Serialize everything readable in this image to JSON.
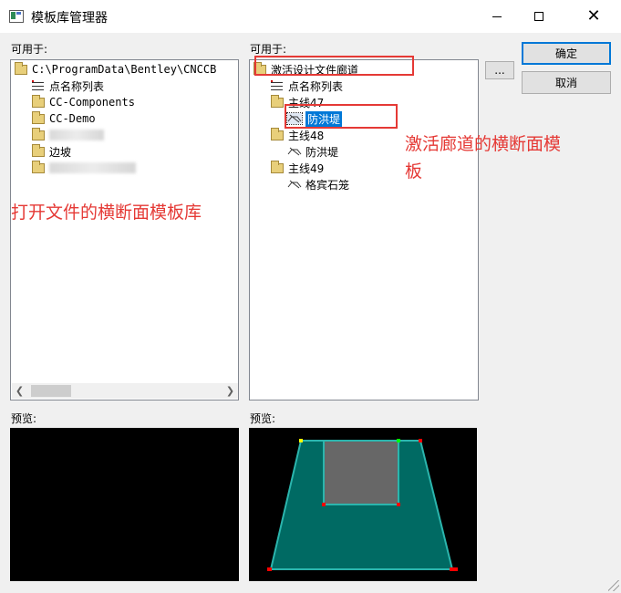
{
  "window": {
    "title": "模板库管理器"
  },
  "left": {
    "available_label": "可用于:",
    "tree": [
      {
        "kind": "folder",
        "label": "C:\\ProgramData\\Bentley\\CNCCB"
      },
      {
        "kind": "list",
        "label": "点名称列表"
      },
      {
        "kind": "folder",
        "label": "CC-Components"
      },
      {
        "kind": "folder",
        "label": "CC-Demo"
      },
      {
        "kind": "folder",
        "label": ""
      },
      {
        "kind": "folder",
        "label": "边坡"
      },
      {
        "kind": "folder",
        "label": ""
      }
    ],
    "preview_label": "预览:"
  },
  "right": {
    "available_label": "可用于:",
    "tree": [
      {
        "kind": "folder",
        "label": "激活设计文件廊道"
      },
      {
        "kind": "list",
        "label": "点名称列表"
      },
      {
        "kind": "folder",
        "label": "主线47"
      },
      {
        "kind": "template",
        "label": "防洪堤",
        "selected": true
      },
      {
        "kind": "folder",
        "label": "主线48"
      },
      {
        "kind": "template",
        "label": "防洪堤"
      },
      {
        "kind": "folder",
        "label": "主线49"
      },
      {
        "kind": "template",
        "label": "格宾石笼"
      }
    ],
    "preview_label": "预览:"
  },
  "buttons": {
    "browse": "...",
    "ok": "确定",
    "cancel": "取消"
  },
  "annotations": {
    "left_library": "打开文件的横断面模板库",
    "active_corridor_line1": "激活廊道的横断面模",
    "active_corridor_line2": "板"
  },
  "colors": {
    "annotation": "#e53935",
    "preview_fill": "#006a63",
    "preview_edge": "#2bb5ad",
    "selection": "#0078d7"
  }
}
